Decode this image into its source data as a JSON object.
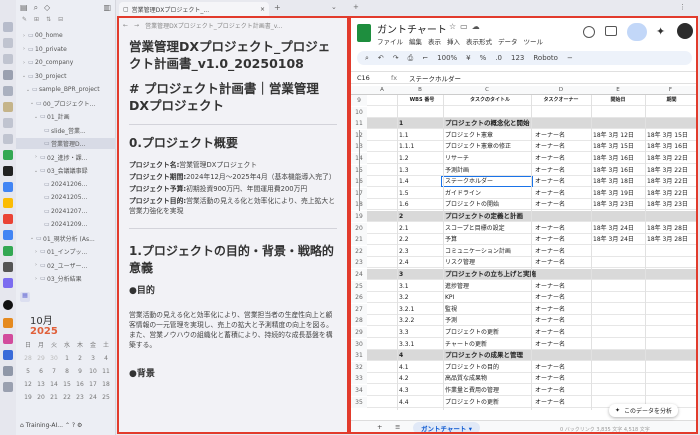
{
  "sidebar": {
    "items": [
      {
        "label": "00_home",
        "indent": 1,
        "arrow": "›"
      },
      {
        "label": "10_private",
        "indent": 1,
        "arrow": "›"
      },
      {
        "label": "20_company",
        "indent": 1,
        "arrow": "›"
      },
      {
        "label": "30_project",
        "indent": 1,
        "arrow": "⌄"
      },
      {
        "label": "sample_BPR_project",
        "indent": 2,
        "arrow": "⌄"
      },
      {
        "label": "00_プロジェクト...",
        "indent": 3,
        "arrow": "⌄"
      },
      {
        "label": "01_計画",
        "indent": 4,
        "arrow": "⌄"
      },
      {
        "label": "slide_営業...",
        "indent": 5,
        "arrow": ""
      },
      {
        "label": "営業管理D...",
        "indent": 5,
        "arrow": "",
        "selected": true
      },
      {
        "label": "02_進捗・課...",
        "indent": 4,
        "arrow": "›"
      },
      {
        "label": "03_会議議事録",
        "indent": 4,
        "arrow": "⌄"
      },
      {
        "label": "20241206...",
        "indent": 5,
        "arrow": ""
      },
      {
        "label": "20241205...",
        "indent": 5,
        "arrow": ""
      },
      {
        "label": "20241207...",
        "indent": 5,
        "arrow": ""
      },
      {
        "label": "20241209...",
        "indent": 5,
        "arrow": ""
      },
      {
        "label": "01_現状分析 (As...",
        "indent": 3,
        "arrow": "⌄"
      },
      {
        "label": "01_インプッ...",
        "indent": 4,
        "arrow": "›"
      },
      {
        "label": "02_ユーザー...",
        "indent": 4,
        "arrow": "›"
      },
      {
        "label": "03_分析結果",
        "indent": 4,
        "arrow": "›"
      }
    ],
    "calendar": {
      "month": "10月",
      "year": "2025",
      "weekdays": [
        "日",
        "月",
        "火",
        "水",
        "木",
        "金",
        "土"
      ],
      "days": [
        "28",
        "29",
        "30",
        "1",
        "2",
        "3",
        "4",
        "5",
        "6",
        "7",
        "8",
        "9",
        "10",
        "11",
        "12",
        "13",
        "14",
        "15",
        "16",
        "17",
        "18",
        "19",
        "20",
        "21",
        "22",
        "23",
        "24",
        "25"
      ]
    },
    "vault": "Training-AI..."
  },
  "doc": {
    "tab_title": "営業管理DXプロジェクト_...",
    "nav_title": "営業管理DXプロジェクト_プロジェクト計画書_v...",
    "title": "営業管理DXプロジェクト_プロジェクト計画書_v1.0_20250108",
    "h1": "# プロジェクト計画書｜営業管理DXプロジェクト",
    "h2a": "0.プロジェクト概要",
    "facts": [
      {
        "k": "プロジェクト名:",
        "v": "営業管理DXプロジェクト"
      },
      {
        "k": "プロジェクト期間:",
        "v": "2024年12月〜2025年4月（基本機能導入完了）"
      },
      {
        "k": "プロジェクト予算:",
        "v": "初期投資900万円、年間運用費200万円"
      },
      {
        "k": "プロジェクト目的:",
        "v": "営業活動の見える化と効率化により、売上拡大と営業力強化を実現"
      }
    ],
    "h2b": "1.プロジェクトの目的・背景・戦略的意義",
    "h3": "●目的",
    "para": "営業活動の見える化と効率化により、営業担当者の生産性向上と顧客情報の一元管理を実現し、売上の拡大と予測精度の向上を図る。また、営業ノウハウの組織化と蓄積により、持続的な成長基盤を構築する。",
    "h3b": "●背景"
  },
  "sheet": {
    "title": "ガントチャート",
    "menus": [
      "ファイル",
      "編集",
      "表示",
      "挿入",
      "表示形式",
      "データ",
      "ツール"
    ],
    "cellref": "C16",
    "formula": "ステークホルダー",
    "font": "Roboto",
    "zoom": "123",
    "cols": [
      "A",
      "B",
      "C",
      "D",
      "E",
      "F"
    ],
    "headers": [
      "WBS 番号",
      "タスクのタイトル",
      "タスクオーナー",
      "開始日",
      "期間"
    ],
    "rows": [
      {
        "n": "9",
        "sect": false,
        "cells": [
          "",
          "",
          "",
          "",
          ""
        ]
      },
      {
        "n": "10",
        "sect": false,
        "cells": [
          "",
          "",
          "",
          "",
          ""
        ]
      },
      {
        "n": "11",
        "sect": true,
        "cells": [
          "1",
          "プロジェクトの概念化と開始",
          "",
          "",
          ""
        ]
      },
      {
        "n": "12",
        "sect": false,
        "cells": [
          "1.1",
          "プロジェクト憲章",
          "オーナー名",
          "18年 3月 12日",
          "18年 3月 15日"
        ]
      },
      {
        "n": "13",
        "sect": false,
        "cells": [
          "1.1.1",
          "プロジェクト憲章の修正",
          "オーナー名",
          "18年 3月 15日",
          "18年 3月 16日"
        ]
      },
      {
        "n": "14",
        "sect": false,
        "cells": [
          "1.2",
          "リサーチ",
          "オーナー名",
          "18年 3月 16日",
          "18年 3月 22日"
        ]
      },
      {
        "n": "15",
        "sect": false,
        "cells": [
          "1.3",
          "予測計画",
          "オーナー名",
          "18年 3月 16日",
          "18年 3月 22日"
        ]
      },
      {
        "n": "16",
        "sect": false,
        "cells": [
          "1.4",
          "ステークホルダー",
          "オーナー名",
          "18年 3月 18日",
          "18年 3月 22日"
        ],
        "active": true
      },
      {
        "n": "17",
        "sect": false,
        "cells": [
          "1.5",
          "ガイドライン",
          "オーナー名",
          "18年 3月 19日",
          "18年 3月 22日"
        ]
      },
      {
        "n": "18",
        "sect": false,
        "cells": [
          "1.6",
          "プロジェクトの開始",
          "オーナー名",
          "18年 3月 23日",
          "18年 3月 23日"
        ]
      },
      {
        "n": "19",
        "sect": true,
        "cells": [
          "2",
          "プロジェクトの定義と計画",
          "",
          "",
          ""
        ]
      },
      {
        "n": "20",
        "sect": false,
        "cells": [
          "2.1",
          "スコープと目標の設定",
          "オーナー名",
          "18年 3月 24日",
          "18年 3月 28日"
        ]
      },
      {
        "n": "21",
        "sect": false,
        "cells": [
          "2.2",
          "予算",
          "オーナー名",
          "18年 3月 24日",
          "18年 3月 28日"
        ]
      },
      {
        "n": "22",
        "sect": false,
        "cells": [
          "2.3",
          "コミュニケーション計画",
          "オーナー名",
          "",
          ""
        ]
      },
      {
        "n": "23",
        "sect": false,
        "cells": [
          "2.4",
          "リスク管理",
          "オーナー名",
          "",
          ""
        ]
      },
      {
        "n": "24",
        "sect": true,
        "cells": [
          "3",
          "プロジェクトの立ち上げと実施",
          "",
          "",
          ""
        ]
      },
      {
        "n": "25",
        "sect": false,
        "cells": [
          "3.1",
          "進捗管理",
          "オーナー名",
          "",
          ""
        ]
      },
      {
        "n": "26",
        "sect": false,
        "cells": [
          "3.2",
          "KPI",
          "オーナー名",
          "",
          ""
        ]
      },
      {
        "n": "27",
        "sect": false,
        "cells": [
          "3.2.1",
          "監視",
          "オーナー名",
          "",
          ""
        ]
      },
      {
        "n": "28",
        "sect": false,
        "cells": [
          "3.2.2",
          "予測",
          "オーナー名",
          "",
          ""
        ]
      },
      {
        "n": "29",
        "sect": false,
        "cells": [
          "3.3",
          "プロジェクトの更新",
          "オーナー名",
          "",
          ""
        ]
      },
      {
        "n": "30",
        "sect": false,
        "cells": [
          "3.3.1",
          "チャートの更新",
          "オーナー名",
          "",
          ""
        ]
      },
      {
        "n": "31",
        "sect": true,
        "cells": [
          "4",
          "プロジェクトの成果と管理",
          "",
          "",
          ""
        ]
      },
      {
        "n": "32",
        "sect": false,
        "cells": [
          "4.1",
          "プロジェクトの目的",
          "オーナー名",
          "",
          ""
        ]
      },
      {
        "n": "33",
        "sect": false,
        "cells": [
          "4.2",
          "高品質な成果物",
          "オーナー名",
          "",
          ""
        ]
      },
      {
        "n": "34",
        "sect": false,
        "cells": [
          "4.3",
          "作業量と費用の管理",
          "オーナー名",
          "",
          ""
        ]
      },
      {
        "n": "35",
        "sect": false,
        "cells": [
          "4.4",
          "プロジェクトの更新",
          "オーナー名",
          "",
          ""
        ]
      }
    ],
    "sheet_tab": "ガントチャート",
    "explore": "このデータを分析",
    "status": "0 バックリンク",
    "count": "3,835 文字 4,518 文字"
  }
}
